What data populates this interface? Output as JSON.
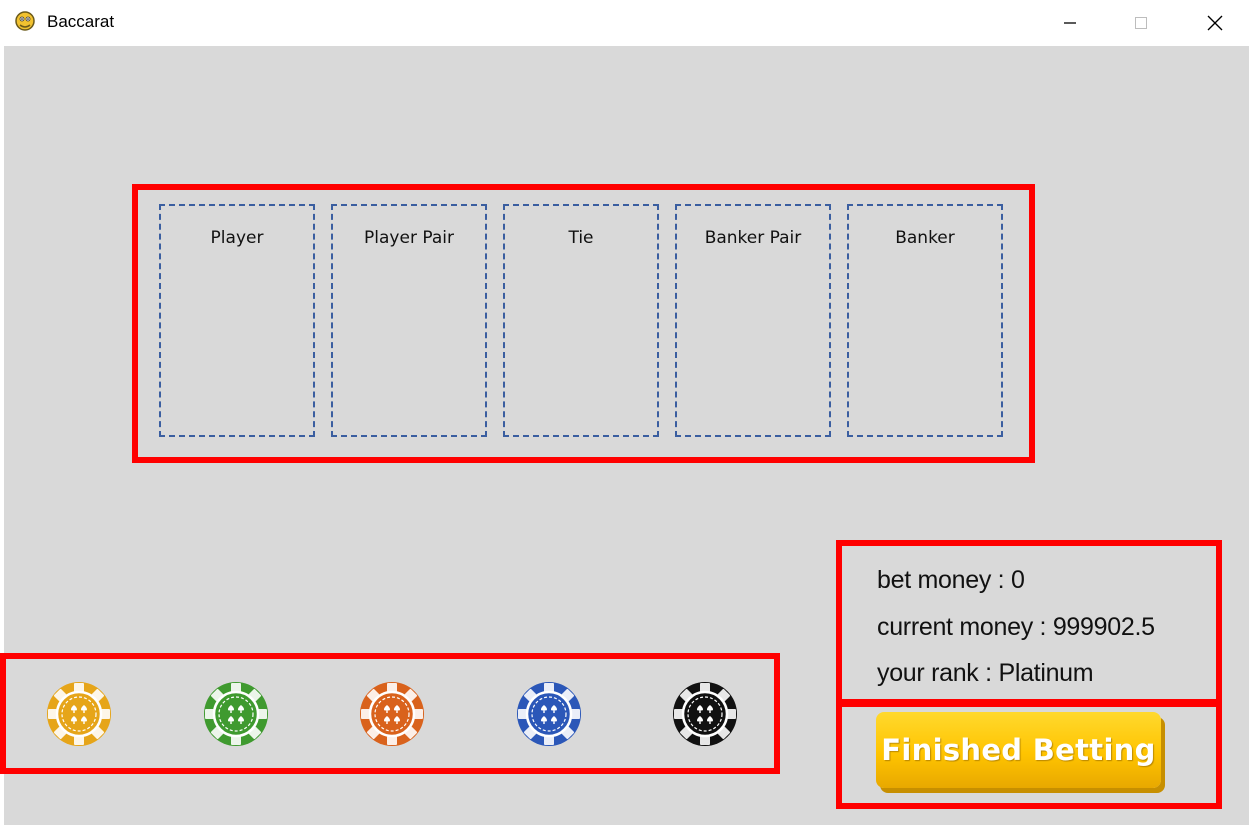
{
  "window": {
    "title": "Baccarat"
  },
  "betting_areas": [
    {
      "label": "Player"
    },
    {
      "label": "Player Pair"
    },
    {
      "label": "Tie"
    },
    {
      "label": "Banker Pair"
    },
    {
      "label": "Banker"
    }
  ],
  "chips": [
    {
      "color": "#e6a519",
      "icon": "chip-icon-orange-gold"
    },
    {
      "color": "#3f9a2f",
      "icon": "chip-icon-green"
    },
    {
      "color": "#d9621c",
      "icon": "chip-icon-orange"
    },
    {
      "color": "#2b57b8",
      "icon": "chip-icon-blue"
    },
    {
      "color": "#111111",
      "icon": "chip-icon-black"
    }
  ],
  "status": {
    "bet_money": "bet money : 0",
    "current_money": "current money : 999902.5",
    "rank": "your rank : Platinum"
  },
  "actions": {
    "finish_label": "Finished Betting"
  },
  "colors": {
    "highlight": "#ff0000",
    "background": "#d9d9d9",
    "slot_border": "#3a5ea0",
    "button": "#ffc400"
  }
}
